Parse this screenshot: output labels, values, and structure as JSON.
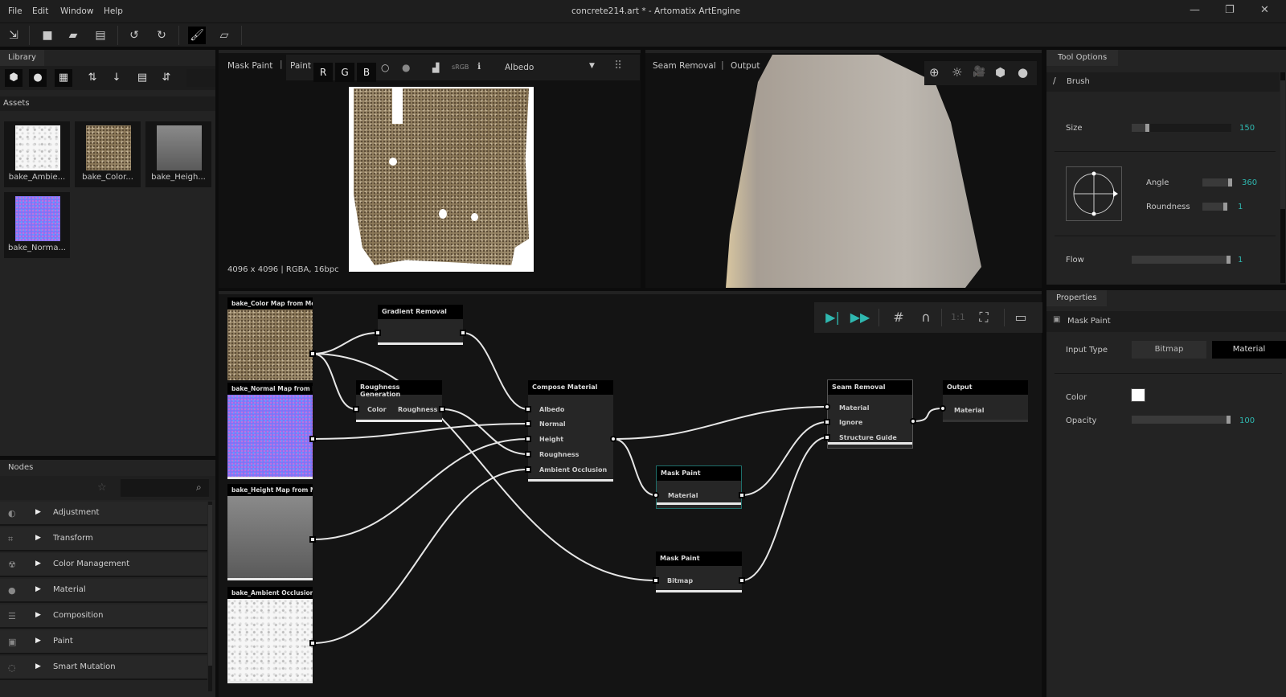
{
  "window": {
    "title": "concrete214.art * - Artomatix ArtEngine",
    "menu": [
      "File",
      "Edit",
      "Window",
      "Help"
    ],
    "controls": [
      "—",
      "❐",
      "✕"
    ]
  },
  "toolbar": {
    "icons": [
      "export-icon",
      "new-file-icon",
      "open-folder-icon",
      "save-icon",
      "undo-icon",
      "redo-icon",
      "brush-icon",
      "eraser-icon"
    ]
  },
  "library": {
    "tab": "Library",
    "assets_label": "Assets",
    "assets": [
      {
        "label": "bake_Ambie..."
      },
      {
        "label": "bake_Color..."
      },
      {
        "label": "bake_Heigh..."
      },
      {
        "label": "bake_Norma..."
      }
    ]
  },
  "nodes_panel": {
    "tab": "Nodes",
    "search_placeholder": "",
    "items": [
      {
        "icon": "◐",
        "label": "Adjustment"
      },
      {
        "icon": "⌗",
        "label": "Transform"
      },
      {
        "icon": "☢",
        "label": "Color Management"
      },
      {
        "icon": "●",
        "label": "Material"
      },
      {
        "icon": "☰",
        "label": "Composition"
      },
      {
        "icon": "▣",
        "label": "Paint"
      },
      {
        "icon": "◌",
        "label": "Smart Mutation"
      }
    ]
  },
  "viewport2d": {
    "node": "Mask Paint",
    "mode": "Paint",
    "channels": [
      "R",
      "G",
      "B"
    ],
    "colorspace": "sRGB",
    "map_select": "Albedo",
    "info": "4096 x 4096 | RGBA, 16bpc"
  },
  "viewport3d": {
    "node": "Seam Removal",
    "mode": "Output"
  },
  "graph": {
    "toolbar": {
      "ratio": "1:1"
    },
    "inputs": [
      {
        "title": "bake_Color Map from Mesh"
      },
      {
        "title": "bake_Normal Map from Me"
      },
      {
        "title": "bake_Height Map from Me"
      },
      {
        "title": "bake_Ambient Occlusion M"
      }
    ],
    "gradient_removal": {
      "title": "Gradient Removal"
    },
    "roughness_generation": {
      "title": "Roughness Generation",
      "in": "Color",
      "out": "Roughness"
    },
    "compose": {
      "title": "Compose Material",
      "inputs": [
        "Albedo",
        "Normal",
        "Height",
        "Roughness",
        "Ambient Occlusion"
      ]
    },
    "mask_paint_1": {
      "title": "Mask Paint",
      "port": "Material"
    },
    "mask_paint_2": {
      "title": "Mask Paint",
      "port": "Bitmap"
    },
    "seam_removal": {
      "title": "Seam Removal",
      "inputs": [
        "Material",
        "Ignore",
        "Structure Guide"
      ]
    },
    "output": {
      "title": "Output",
      "port": "Material"
    }
  },
  "tool_options": {
    "tab": "Tool Options",
    "section": "Brush",
    "size_label": "Size",
    "size": "150",
    "size_fraction": 0.15,
    "angle_label": "Angle",
    "angle": "360",
    "angle_fraction": 1.0,
    "roundness_label": "Roundness",
    "roundness": "1",
    "roundness_fraction": 1.0,
    "flow_label": "Flow",
    "flow": "1",
    "flow_fraction": 1.0
  },
  "properties": {
    "tab": "Properties",
    "section": "Mask Paint",
    "input_type_label": "Input Type",
    "input_types": [
      "Bitmap",
      "Material"
    ],
    "selected_input_type": "Material",
    "color_label": "Color",
    "color": "#ffffff",
    "opacity_label": "Opacity",
    "opacity": "100",
    "opacity_fraction": 1.0
  },
  "colors": {
    "accent": "#2fb8b0",
    "bg": "#0c0c0c",
    "panel": "#232323"
  }
}
